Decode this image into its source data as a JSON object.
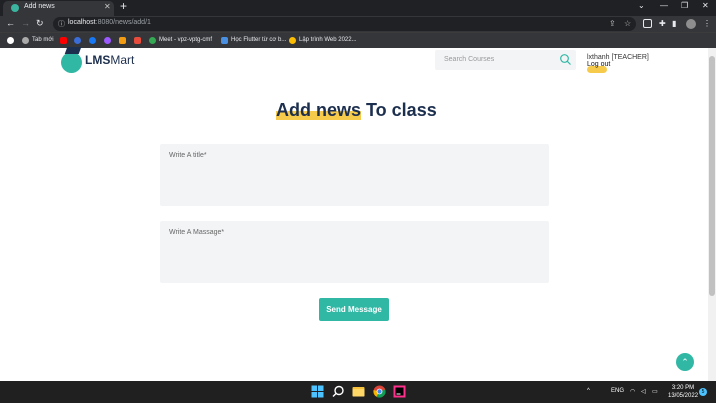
{
  "browser": {
    "tab_title": "Add news",
    "url_host": "localhost",
    "url_path": ":8080/news/add/1",
    "bookmarks": [
      "Tab mới",
      "Meet - vpz-vptg-cmf",
      "Học Flutter từ cơ b...",
      "Lập trình Web 2022..."
    ]
  },
  "site": {
    "logo_bold": "LMS",
    "logo_rest": "Mart",
    "search_placeholder": "Search Courses",
    "user": "lxthanh [TEACHER]",
    "logout": "Log out"
  },
  "form": {
    "heading_highlight": "Add news",
    "heading_rest": " To class",
    "title_placeholder": "Write A title*",
    "message_placeholder": "Write A Massage*",
    "submit": "Send Message"
  },
  "taskbar": {
    "lang": "ENG",
    "time": "3:20 PM",
    "date": "13/05/2022",
    "notifications": "5"
  },
  "colors": {
    "accent": "#31b8a5",
    "highlight": "#f6cb4b",
    "navy": "#1d2f4e"
  }
}
